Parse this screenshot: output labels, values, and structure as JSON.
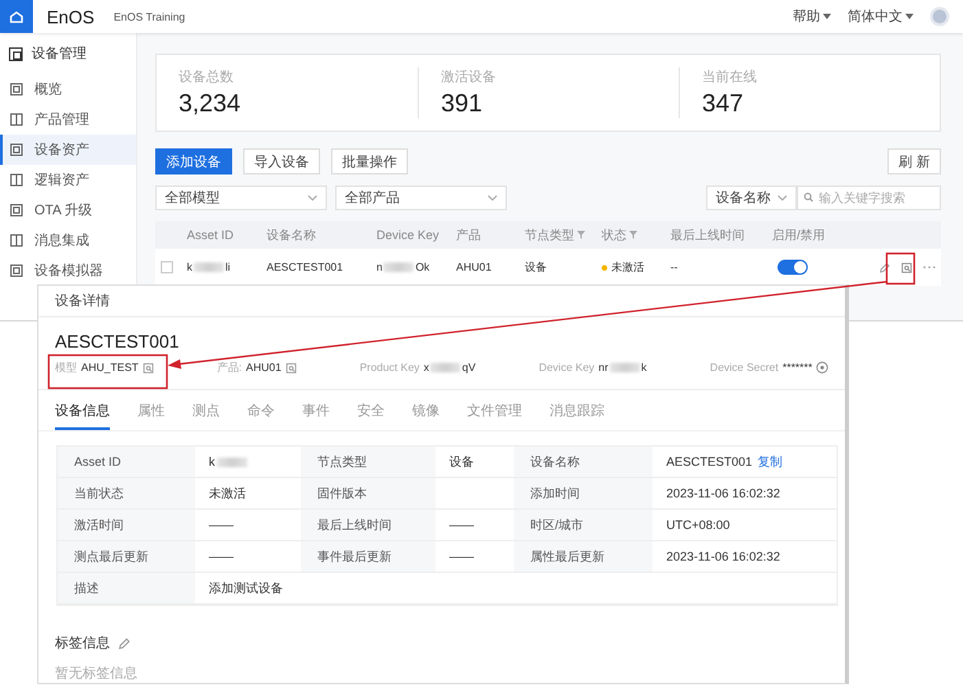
{
  "header": {
    "logo": "EnOS",
    "org": "EnOS Training",
    "menus": [
      {
        "label": "帮助"
      },
      {
        "label": "简体中文"
      }
    ]
  },
  "sidebar": {
    "title": "设备管理",
    "items": [
      {
        "label": "概览",
        "selected": false
      },
      {
        "label": "产品管理",
        "selected": false
      },
      {
        "label": "设备资产",
        "selected": true
      },
      {
        "label": "逻辑资产",
        "selected": false
      },
      {
        "label": "OTA 升级",
        "selected": false
      },
      {
        "label": "消息集成",
        "selected": false
      },
      {
        "label": "设备模拟器",
        "selected": false
      }
    ]
  },
  "stats": [
    {
      "label": "设备总数",
      "value": "3,234"
    },
    {
      "label": "激活设备",
      "value": "391"
    },
    {
      "label": "当前在线",
      "value": "347"
    }
  ],
  "toolbar": {
    "buttons": [
      {
        "label": "添加设备",
        "primary": true
      },
      {
        "label": "导入设备",
        "primary": false
      },
      {
        "label": "批量操作",
        "primary": false
      }
    ],
    "refresh": "刷 新"
  },
  "filters": {
    "model": "全部模型",
    "product": "全部产品",
    "search_field": "设备名称",
    "search": {
      "placeholder": "输入关键字搜索"
    }
  },
  "table": {
    "columns": [
      {
        "label": "Asset ID",
        "filter": false
      },
      {
        "label": "设备名称",
        "filter": false
      },
      {
        "label": "Device Key",
        "filter": false
      },
      {
        "label": "产品",
        "filter": false
      },
      {
        "label": "节点类型",
        "filter": true
      },
      {
        "label": "状态",
        "filter": true
      },
      {
        "label": "最后上线时间",
        "filter": false
      },
      {
        "label": "启用/禁用",
        "filter": false
      }
    ],
    "rows": [
      {
        "checked": false,
        "asset_id": {
          "start": "k",
          "end": "li"
        },
        "name": "AESCTEST001",
        "device_key": {
          "start": "n",
          "end": "Ok"
        },
        "product": "AHU01",
        "node_type": "设备",
        "status": "未激活",
        "color": "#f5b400",
        "last_online": "--",
        "enabled": true
      }
    ]
  },
  "detail": {
    "title": "设备详情",
    "name": "AESCTEST001",
    "meta": [
      {
        "kind": "link",
        "label": "模型",
        "value": "AHU_TEST"
      },
      {
        "kind": "link",
        "label": "产品:",
        "value": "AHU01"
      },
      {
        "kind": "masked",
        "label": "Product Key",
        "value": {
          "start": "x",
          "end": "qV"
        }
      },
      {
        "kind": "masked",
        "label": "Device Key",
        "value": {
          "start": "nr",
          "end": "k"
        }
      },
      {
        "kind": "secret",
        "label": "Device Secret",
        "value": "*******"
      }
    ],
    "tabs": [
      {
        "label": "设备信息",
        "selected": true
      },
      {
        "label": "属性",
        "selected": false
      },
      {
        "label": "测点",
        "selected": false
      },
      {
        "label": "命令",
        "selected": false
      },
      {
        "label": "事件",
        "selected": false
      },
      {
        "label": "安全",
        "selected": false
      },
      {
        "label": "镜像",
        "selected": false
      },
      {
        "label": "文件管理",
        "selected": false
      },
      {
        "label": "消息跟踪",
        "selected": false
      }
    ],
    "info_rows": [
      [
        {
          "label": "Asset ID",
          "value": {
            "start": "k"
          }
        },
        {
          "label": "节点类型",
          "value": "设备"
        },
        {
          "label": "设备名称",
          "value": "AESCTEST001",
          "action": "复制"
        }
      ],
      [
        {
          "label": "当前状态",
          "value": "未激活"
        },
        {
          "label": "固件版本"
        },
        {
          "label": "添加时间",
          "value": "2023-11-06 16:02:32"
        }
      ],
      [
        {
          "label": "激活时间",
          "value": "——"
        },
        {
          "label": "最后上线时间",
          "value": "——"
        },
        {
          "label": "时区/城市",
          "value": "UTC+08:00"
        }
      ],
      [
        {
          "label": "测点最后更新",
          "value": "——"
        },
        {
          "label": "事件最后更新",
          "value": "——"
        },
        {
          "label": "属性最后更新",
          "value": "2023-11-06 16:02:32"
        }
      ],
      [
        {
          "label": "描述",
          "value": "添加测试设备"
        }
      ]
    ],
    "tags": {
      "title": "标签信息",
      "empty": "暂无标签信息"
    }
  }
}
